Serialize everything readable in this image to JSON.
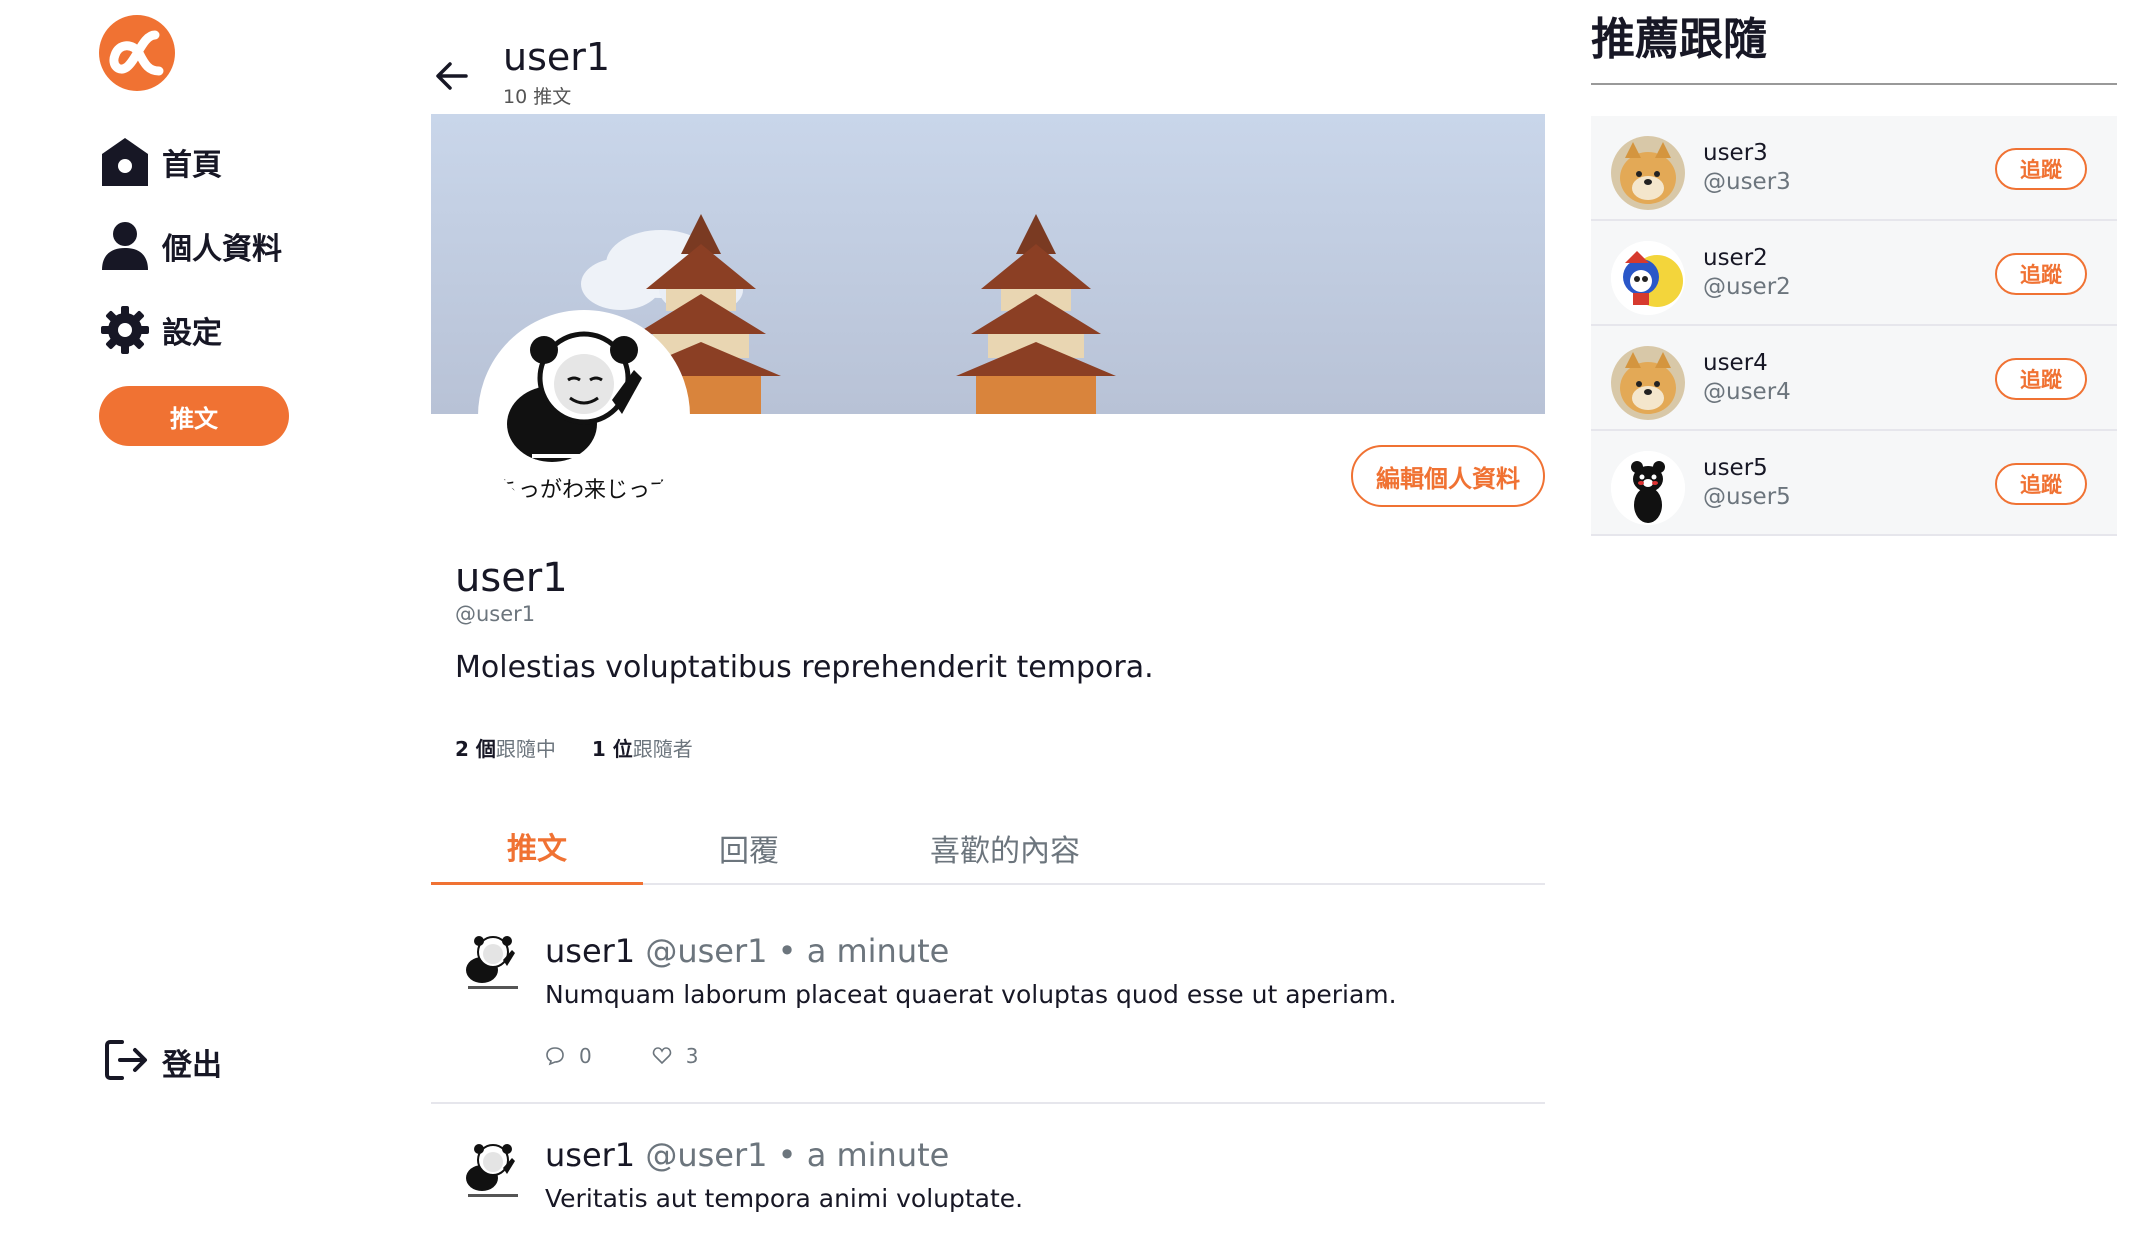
{
  "nav": {
    "home_label": "首頁",
    "profile_label": "個人資料",
    "settings_label": "設定",
    "tweet_button": "推文",
    "logout_label": "登出"
  },
  "header": {
    "name": "user1",
    "tweet_count": "10 推文"
  },
  "profile": {
    "avatar_caption": "ちっがわ来じっず",
    "edit_button": "編輯個人資料",
    "name": "user1",
    "handle": "@user1",
    "bio": "Molestias voluptatibus reprehenderit tempora.",
    "following_num": "2 個",
    "following_label": "跟隨中",
    "followers_num": "1 位",
    "followers_label": "跟隨者"
  },
  "tabs": [
    "推文",
    "回覆",
    "喜歡的內容"
  ],
  "tweets": [
    {
      "name": "user1",
      "handle": "@user1",
      "time": "• a minute",
      "text": "Numquam laborum placeat quaerat voluptas quod esse ut aperiam.",
      "replies": "0",
      "likes": "3"
    },
    {
      "name": "user1",
      "handle": "@user1",
      "time": "• a minute",
      "text": "Veritatis aut tempora animi voluptate."
    }
  ],
  "recommend": {
    "title": "推薦跟隨",
    "users": [
      {
        "name": "user3",
        "handle": "@user3",
        "button": "追蹤"
      },
      {
        "name": "user2",
        "handle": "@user2",
        "button": "追蹤"
      },
      {
        "name": "user4",
        "handle": "@user4",
        "button": "追蹤"
      },
      {
        "name": "user5",
        "handle": "@user5",
        "button": "追蹤"
      }
    ]
  },
  "colors": {
    "accent": "#f07233",
    "muted": "#6c757d"
  }
}
